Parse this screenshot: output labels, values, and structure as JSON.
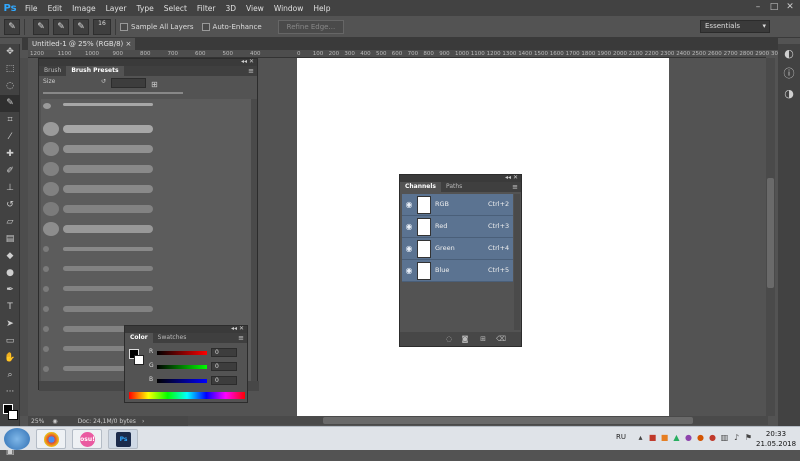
{
  "app": {
    "logo": "Ps"
  },
  "menu": [
    "File",
    "Edit",
    "Image",
    "Layer",
    "Type",
    "Select",
    "Filter",
    "3D",
    "View",
    "Window",
    "Help"
  ],
  "window_controls": {
    "minimize": "–",
    "maximize": "□",
    "close": "✕"
  },
  "options_bar": {
    "brush_size": "16",
    "sample_all_layers": "Sample All Layers",
    "auto_enhance": "Auto-Enhance",
    "refine_edge": "Refine Edge...",
    "workspace": "Essentials"
  },
  "document": {
    "tab_title": "Untitled-1 @ 25% (RGB/8)",
    "tab_close": "×"
  },
  "ruler": [
    "1200",
    "1100",
    "1000",
    "900",
    "800",
    "700",
    "600",
    "500",
    "400",
    "0",
    "100",
    "200",
    "300",
    "400",
    "500",
    "600",
    "700",
    "800",
    "900",
    "1000",
    "1100",
    "1200",
    "1300",
    "1400",
    "1500",
    "1600",
    "1700",
    "1800",
    "1900",
    "2000",
    "2100",
    "2200",
    "2300",
    "2400",
    "2500",
    "2600",
    "2700",
    "2800",
    "2900",
    "3000"
  ],
  "brush_panel": {
    "tabs": [
      "Brush",
      "Brush Presets"
    ],
    "active_tab": "Brush Presets",
    "size_label": "Size"
  },
  "color_panel": {
    "tabs": [
      "Color",
      "Swatches"
    ],
    "active_tab": "Color",
    "channels": [
      {
        "label": "R",
        "value": "0"
      },
      {
        "label": "G",
        "value": "0"
      },
      {
        "label": "B",
        "value": "0"
      }
    ]
  },
  "channels_panel": {
    "tabs": [
      "Channels",
      "Paths"
    ],
    "active_tab": "Channels",
    "rows": [
      {
        "name": "RGB",
        "shortcut": "Ctrl+2"
      },
      {
        "name": "Red",
        "shortcut": "Ctrl+3"
      },
      {
        "name": "Green",
        "shortcut": "Ctrl+4"
      },
      {
        "name": "Blue",
        "shortcut": "Ctrl+5"
      }
    ]
  },
  "status": {
    "zoom": "25%",
    "doc_info": "Doc: 24,1M/0 bytes"
  },
  "taskbar": {
    "lang": "RU",
    "time": "20:33",
    "date": "21.05.2018",
    "apps": [
      {
        "name": "chrome",
        "color": "#d64b3d"
      },
      {
        "name": "osu!",
        "label": "osu!",
        "color": "#ea5aa1"
      },
      {
        "name": "photoshop",
        "label": "Ps",
        "color": "#1b2b4c"
      }
    ]
  },
  "colors": {
    "accent": "#31a8ff",
    "channel_row": "#5b7391"
  }
}
